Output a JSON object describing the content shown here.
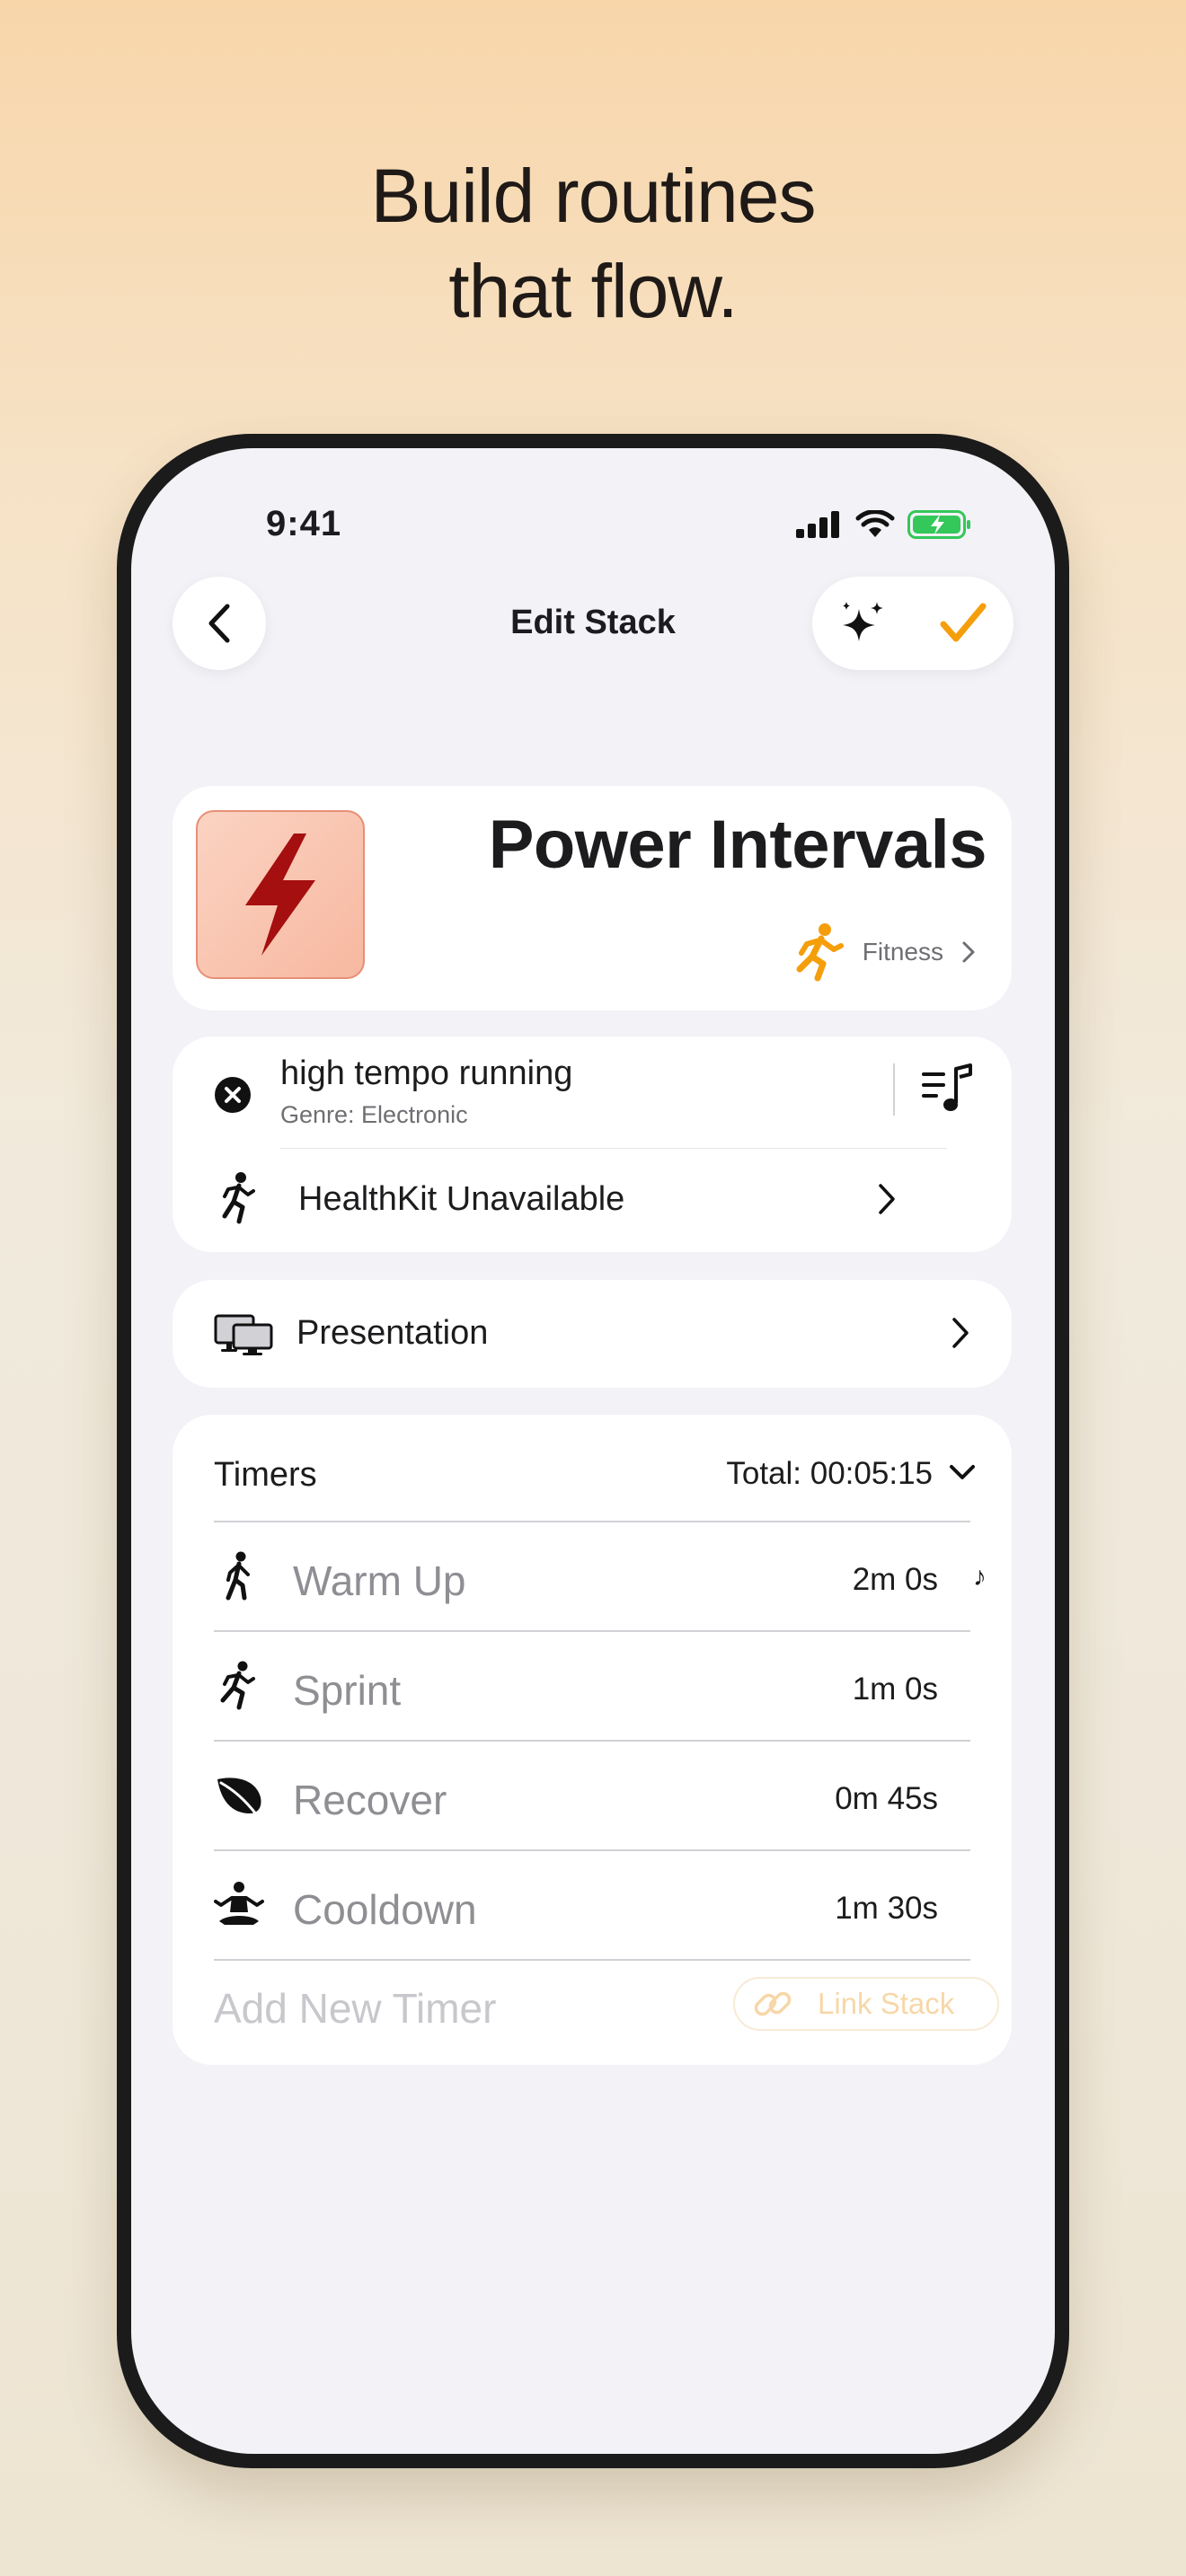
{
  "headline": {
    "line1": "Build routines",
    "line2": "that flow."
  },
  "status_bar": {
    "time": "9:41",
    "icons": [
      "signal-icon",
      "wifi-icon",
      "battery-charging-icon"
    ]
  },
  "nav": {
    "title": "Edit Stack",
    "back_icon": "chevron-left-icon",
    "ai_icon": "sparkles-icon",
    "done_icon": "checkmark-icon",
    "accent": "#f59e0b"
  },
  "stack": {
    "title": "Power Intervals",
    "icon": "bolt-icon",
    "icon_color": "#a50f0f",
    "category": "Fitness",
    "category_icon": "running-figure-icon"
  },
  "music": {
    "title": "high tempo running",
    "subtitle": "Genre: Electronic"
  },
  "health": {
    "label": "HealthKit Unavailable"
  },
  "presentation": {
    "label": "Presentation"
  },
  "timers": {
    "label": "Timers",
    "total": "Total: 00:05:15",
    "items": [
      {
        "name": "Warm Up",
        "duration": "2m 0s",
        "icon": "walking-figure-icon",
        "has_music": true
      },
      {
        "name": "Sprint",
        "duration": "1m 0s",
        "icon": "running-figure-icon",
        "has_music": false
      },
      {
        "name": "Recover",
        "duration": "0m 45s",
        "icon": "leaf-icon",
        "has_music": false
      },
      {
        "name": "Cooldown",
        "duration": "1m 30s",
        "icon": "meditation-figure-icon",
        "has_music": false
      }
    ],
    "add_placeholder": "Add New Timer",
    "link_stack": "Link Stack"
  }
}
